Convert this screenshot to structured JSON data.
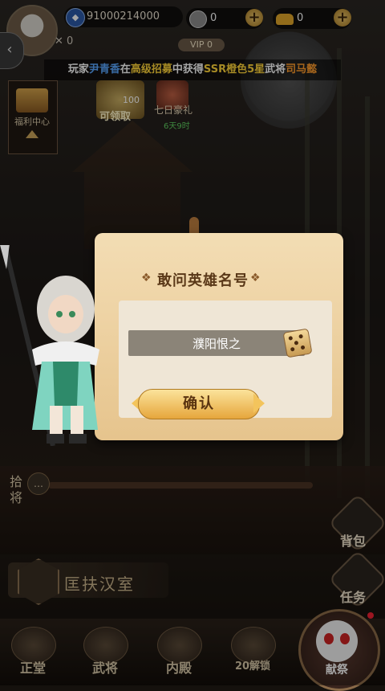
{
  "top_bar": {
    "player_id": "91000214000",
    "silver": "0",
    "gold": "0",
    "swords": "0",
    "vip": "VIP 0"
  },
  "marquee": {
    "prefix": "玩家",
    "player": "尹青香",
    "mid1": "在",
    "event": "高级招募",
    "mid2": "中获得",
    "rarity": "SSR橙色5星",
    "mid3": "武将",
    "general": "司马懿"
  },
  "left_panel": {
    "welfare_label": "福利中心",
    "gift1_count": "100",
    "gift1_label": "可领取",
    "gift2_label": "七日豪礼",
    "gift2_timer": "6天9时"
  },
  "dialog": {
    "title": "敢问英雄名号",
    "name_value": "濮阳恨之",
    "confirm_label": "确认"
  },
  "side": {
    "shijiang": "拾将",
    "bag": "背包",
    "task": "任务",
    "kuangfu": "匡扶汉室"
  },
  "bottom_nav": {
    "items": [
      {
        "label": "正堂"
      },
      {
        "label": "武将"
      },
      {
        "label": "内殿"
      },
      {
        "label": "20解锁"
      }
    ],
    "big_label": "献祭"
  },
  "colors": {
    "player_blue": "#59a7ff",
    "event_yellow": "#ffd439",
    "general_orange": "#ff9c2b"
  }
}
